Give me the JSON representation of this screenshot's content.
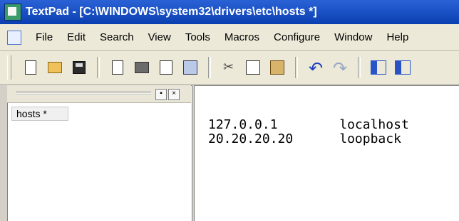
{
  "window": {
    "title": "TextPad - [C:\\WINDOWS\\system32\\drivers\\etc\\hosts *]"
  },
  "menu": {
    "items": [
      "File",
      "Edit",
      "Search",
      "View",
      "Tools",
      "Macros",
      "Configure",
      "Window",
      "Help"
    ]
  },
  "toolbar": {
    "buttons": [
      "new-file-icon",
      "open-folder-icon",
      "save-disk-icon",
      "document-icon",
      "print-icon",
      "print-preview-icon",
      "window-icon",
      "cut-icon",
      "copy-icon",
      "paste-icon",
      "undo-icon",
      "redo-icon",
      "indent-icon",
      "outdent-icon"
    ]
  },
  "left_pane": {
    "open_file": "hosts *"
  },
  "editor": {
    "lines": [
      {
        "ip": "127.0.0.1",
        "host": "localhost"
      },
      {
        "ip": "20.20.20.20",
        "host": "loopback"
      }
    ]
  }
}
